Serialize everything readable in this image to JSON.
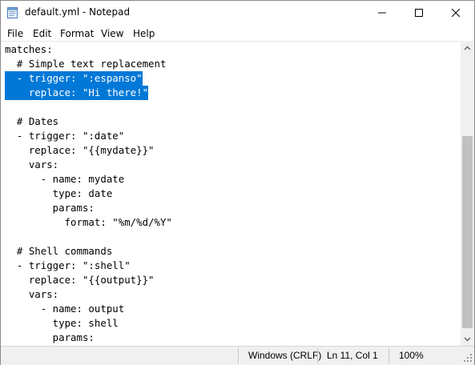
{
  "window": {
    "title": "default.yml - Notepad"
  },
  "menu": {
    "items": [
      "File",
      "Edit",
      "Format",
      "View",
      "Help"
    ]
  },
  "editor": {
    "lines": [
      "matches:",
      "  # Simple text replacement",
      "  - trigger: \":espanso\"",
      "    replace: \"Hi there!\"",
      "",
      "  # Dates",
      "  - trigger: \":date\"",
      "    replace: \"{{mydate}}\"",
      "    vars:",
      "      - name: mydate",
      "        type: date",
      "        params:",
      "          format: \"%m/%d/%Y\"",
      "",
      "  # Shell commands",
      "  - trigger: \":shell\"",
      "    replace: \"{{output}}\"",
      "    vars:",
      "      - name: output",
      "        type: shell",
      "        params:"
    ],
    "selected_lines": [
      2,
      3
    ]
  },
  "status": {
    "line_ending": "Windows (CRLF)",
    "position": "Ln 11, Col 1",
    "zoom": "100%"
  },
  "colors": {
    "selection": "#0078d7",
    "scrollbar_track": "#f0f0f0",
    "scrollbar_thumb": "#c1c1c1"
  }
}
